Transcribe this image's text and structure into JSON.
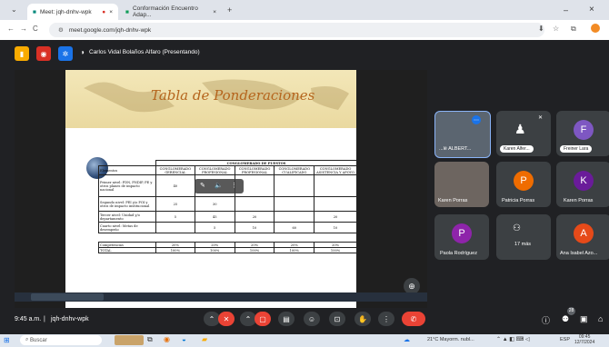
{
  "browser": {
    "tabs": [
      {
        "label": "Meet: jqh-dnhv-wpk"
      },
      {
        "label": "Conformación Encuentro Adap..."
      }
    ],
    "new_tab": "+",
    "url": "meet.google.com/jqh-dnhv-wpk",
    "nav": {
      "back": "←",
      "forward": "→",
      "reload": "C"
    },
    "window_controls": {
      "minimize": "–",
      "close": "×"
    }
  },
  "meet": {
    "presenting_label": "Carlos Vidal Bolaños Alfaro (Presentando)",
    "time": "9:45 a.m.",
    "separator": "|",
    "meeting_code": "jqh-dnhv-wpk",
    "participant_count": "28"
  },
  "slide": {
    "title": "Tabla de Ponderaciones",
    "table": {
      "group_header": "CONGLOMERADO DE PUESTOS",
      "columns": [
        "CONGLOMERADO GERENCIAL",
        "CONGLOMERADO PROFESIONAL",
        "CONGLOMERADO PROFESIONAL",
        "CONGLOMERADO CUALIFICADO",
        "CONGLOMERADO ASISTENCIA Y APOYO"
      ],
      "row_header": "Elementos",
      "rows": [
        {
          "label": "Primer nivel: PDN, PNDIP, PE y otros planes de impacto nacional",
          "values": [
            "40",
            "",
            "",
            "",
            ""
          ]
        },
        {
          "label": "Segundo nivel: PEI y/o POI y otros de impacto institucional",
          "values": [
            "25",
            "30",
            "",
            "",
            ""
          ]
        },
        {
          "label": "Tercer nivel: Unidad y/o departamento",
          "values": [
            "5",
            "45",
            "20",
            "",
            "20"
          ]
        },
        {
          "label": "Cuarto nivel: Metas de desempeño",
          "values": [
            "",
            "5",
            "10",
            "60",
            "10"
          ]
        }
      ],
      "footer_rows": [
        {
          "label": "Competencias",
          "values": [
            "20%",
            "20%",
            "20%",
            "20%",
            "20%"
          ]
        },
        {
          "label": "TOTAL",
          "values": [
            "100%",
            "100%",
            "100%",
            "100%",
            "100%"
          ]
        }
      ]
    }
  },
  "participants": [
    {
      "name": "Carlos Vidal Bolaños Alfaro",
      "label": "...lé ALBERT...",
      "type": "video"
    },
    {
      "name": "Karen Alfaro",
      "label": "Karen Alfer...",
      "type": "avatar",
      "color": "#5f6368"
    },
    {
      "name": "Freiner Lara",
      "label": "Freiner Lara",
      "type": "avatar",
      "initial": "F",
      "color": "#7e57c2"
    },
    {
      "name": "Karen Porras",
      "label": "Karen Porras",
      "type": "video"
    },
    {
      "name": "Patricia Porras",
      "label": "Patricia Porras",
      "type": "avatar",
      "initial": "P",
      "color": "#ef6c00"
    },
    {
      "name": "Karen Porras",
      "label": "Karen Porras",
      "type": "avatar",
      "initial": "K",
      "color": "#6a1b9a"
    },
    {
      "name": "Paola Rodriguez",
      "label": "Paola Rodríguez",
      "type": "avatar",
      "initial": "P",
      "color": "#8e24aa"
    },
    {
      "name": "17 más",
      "label": "17 más",
      "type": "more"
    },
    {
      "name": "Ana Isabel Azofeifa",
      "label": "Ana Isabel Azo...",
      "type": "avatar",
      "initial": "A",
      "color": "#e64a19"
    }
  ],
  "taskbar": {
    "search_placeholder": "Buscar",
    "weather": "21°C Mayorm. nubl...",
    "clock_time": "09:45",
    "clock_date": "12/7/2024",
    "lang": "ESP"
  },
  "colors": {
    "end_call": "#ea4335",
    "accent": "#8ab4f8"
  }
}
